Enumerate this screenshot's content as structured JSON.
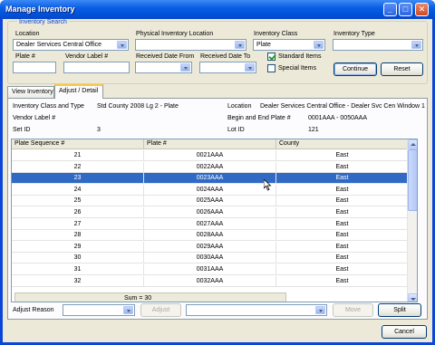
{
  "window": {
    "title": "Manage Inventory"
  },
  "search": {
    "legend": "Inventory Search",
    "location_label": "Location",
    "location_value": "Dealer Services Central Office",
    "physical_location_label": "Physical Inventory Location",
    "physical_location_value": "",
    "inventory_class_label": "Inventory Class",
    "inventory_class_value": "Plate",
    "inventory_type_label": "Inventory Type",
    "inventory_type_value": "",
    "plate_label": "Plate #",
    "vendor_label_label": "Vendor Label #",
    "received_from_label": "Received Date From",
    "received_to_label": "Received Date To",
    "standard_items_label": "Standard Items",
    "standard_items_checked": true,
    "special_items_label": "Special Items",
    "special_items_checked": false,
    "continue_label": "Continue",
    "reset_label": "Reset"
  },
  "tabs": [
    {
      "label": "View Inventory",
      "active": false
    },
    {
      "label": "Adjust / Detail",
      "active": true
    }
  ],
  "detail": {
    "class_type_label": "Inventory Class and Type",
    "class_type_value": "Std County 2008 Lg 2 - Plate",
    "location_label": "Location",
    "location_value": "Dealer Services Central Office - Dealer Svc Cen Window 1",
    "vendor_label_label": "Vendor Label #",
    "vendor_label_value": "",
    "begin_end_label": "Begin and End Plate #",
    "begin_end_value": "0001AAA - 0050AAA",
    "set_id_label": "Set ID",
    "set_id_value": "3",
    "lot_id_label": "Lot ID",
    "lot_id_value": "121"
  },
  "grid": {
    "columns": [
      "Plate Sequence #",
      "Plate #",
      "County"
    ],
    "rows": [
      [
        "21",
        "0021AAA",
        "East"
      ],
      [
        "22",
        "0022AAA",
        "East"
      ],
      [
        "23",
        "0023AAA",
        "East"
      ],
      [
        "24",
        "0024AAA",
        "East"
      ],
      [
        "25",
        "0025AAA",
        "East"
      ],
      [
        "26",
        "0026AAA",
        "East"
      ],
      [
        "27",
        "0027AAA",
        "East"
      ],
      [
        "28",
        "0028AAA",
        "East"
      ],
      [
        "29",
        "0029AAA",
        "East"
      ],
      [
        "30",
        "0030AAA",
        "East"
      ],
      [
        "31",
        "0031AAA",
        "East"
      ],
      [
        "32",
        "0032AAA",
        "East"
      ]
    ],
    "selected_row": 2,
    "footer": "Sum = 30"
  },
  "actions": {
    "adjust_reason_label": "Adjust Reason",
    "adjust_label": "Adjust",
    "move_label": "Move",
    "split_label": "Split",
    "cancel_label": "Cancel"
  },
  "icons": {
    "minimize": "minimize-icon",
    "maximize": "maximize-icon",
    "close": "close-icon"
  }
}
